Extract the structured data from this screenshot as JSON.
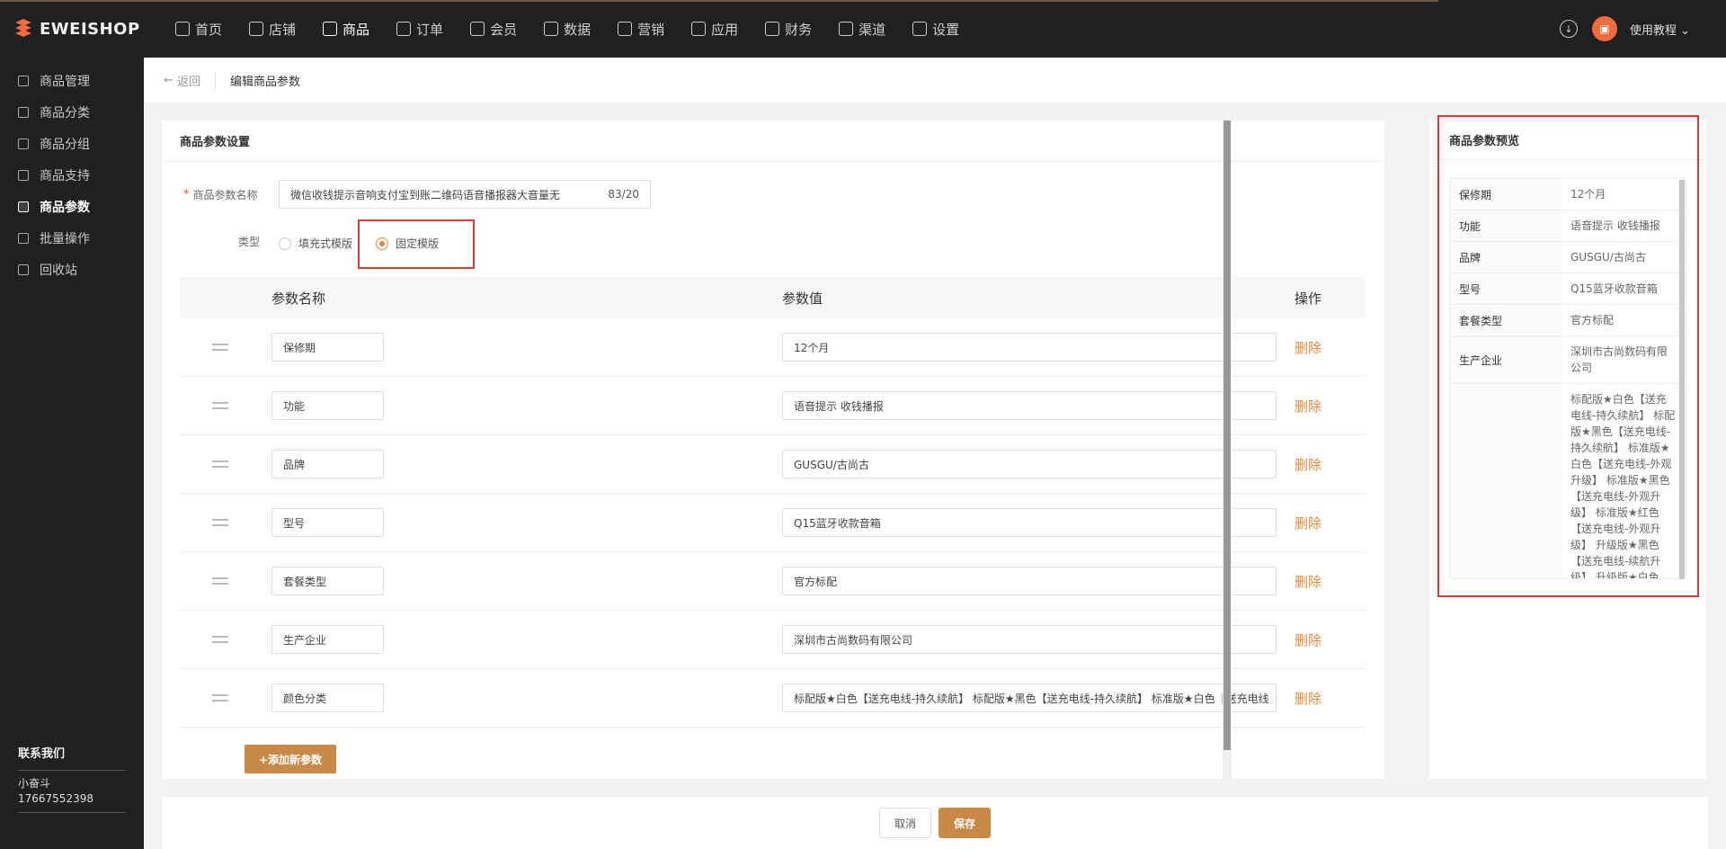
{
  "brand": {
    "name": "EWEISHOP"
  },
  "topnav": [
    {
      "label": "首页",
      "icon": "home-icon"
    },
    {
      "label": "店铺",
      "icon": "store-icon"
    },
    {
      "label": "商品",
      "icon": "goods-icon"
    },
    {
      "label": "订单",
      "icon": "order-icon"
    },
    {
      "label": "会员",
      "icon": "member-icon"
    },
    {
      "label": "数据",
      "icon": "chart-icon"
    },
    {
      "label": "营销",
      "icon": "tag-icon"
    },
    {
      "label": "应用",
      "icon": "app-icon"
    },
    {
      "label": "财务",
      "icon": "finance-icon"
    },
    {
      "label": "渠道",
      "icon": "channel-icon"
    },
    {
      "label": "设置",
      "icon": "gear-icon"
    }
  ],
  "user": {
    "menu_label": "使用教程",
    "chevron": "chevron-down-icon"
  },
  "sidebar": {
    "items": [
      {
        "label": "商品管理"
      },
      {
        "label": "商品分类"
      },
      {
        "label": "商品分组"
      },
      {
        "label": "商品支持"
      },
      {
        "label": "商品参数"
      },
      {
        "label": "批量操作"
      },
      {
        "label": "回收站"
      }
    ],
    "contact": {
      "title": "联系我们",
      "name": "小奋斗",
      "phone": "17667552398"
    }
  },
  "header": {
    "back_label": "返回",
    "title": "编辑商品参数"
  },
  "form": {
    "section_title": "商品参数设置",
    "name_label": "商品参数名称",
    "name_value": "微信收钱提示音响支付宝到账二维码语音播报器大音量无",
    "name_count": "83/20",
    "type_label": "类型",
    "type_options": [
      "填充式模版",
      "固定模版"
    ],
    "type_selected": "固定模版"
  },
  "table": {
    "headers": {
      "name": "参数名称",
      "value": "参数值",
      "op": "操作"
    },
    "delete_label": "删除",
    "rows": [
      {
        "name": "保修期",
        "value": "12个月"
      },
      {
        "name": "功能",
        "value": "语音提示 收钱播报"
      },
      {
        "name": "品牌",
        "value": "GUSGU/古尚古"
      },
      {
        "name": "型号",
        "value": "Q15蓝牙收款音箱"
      },
      {
        "name": "套餐类型",
        "value": "官方标配"
      },
      {
        "name": "生产企业",
        "value": "深圳市古尚数码有限公司"
      },
      {
        "name": "颜色分类",
        "value": "标配版★白色【送充电线-持久续航】 标配版★黑色【送充电线-持久续航】 标准版★白色【送充电线"
      }
    ],
    "add_label": "+添加新参数"
  },
  "preview": {
    "title": "商品参数预览",
    "rows": [
      {
        "k": "保修期",
        "v": "12个月"
      },
      {
        "k": "功能",
        "v": "语音提示 收钱播报"
      },
      {
        "k": "品牌",
        "v": "GUSGU/古尚古"
      },
      {
        "k": "型号",
        "v": "Q15蓝牙收款音箱"
      },
      {
        "k": "套餐类型",
        "v": "官方标配"
      },
      {
        "k": "生产企业",
        "v": "深圳市古尚数码有限公司"
      },
      {
        "k": "",
        "v": "标配版★白色【送充电线-持久续航】 标配版★黑色【送充电线-持久续航】 标准版★白色【送充电线-外观升级】 标准版★黑色【送充电线-外观升级】 标准版★红色【送充电线-外观升级】 升级版★黑色【送充电线-续航升级】 升级版★白色【送充电线-续航升"
      }
    ]
  },
  "footer": {
    "cancel_label": "取消",
    "save_label": "保存"
  }
}
